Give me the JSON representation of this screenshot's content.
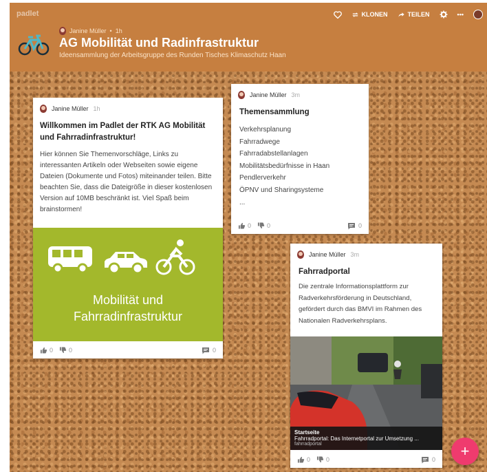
{
  "topbar": {
    "brand": "padlet",
    "actions": {
      "clone": "KLONEN",
      "share": "TEILEN",
      "more": "•••"
    }
  },
  "header": {
    "author": "Janine Müller",
    "time": "1h",
    "title": "AG Mobilität und Radinfrastruktur",
    "subtitle": "Ideensammlung der Arbeitsgruppe des Runden Tisches Klimaschutz Haan"
  },
  "posts": [
    {
      "author": "Janine Müller",
      "time": "1h",
      "title": "Willkommen im Padlet der RTK AG Mobilität und Fahrradinfrastruktur!",
      "body": "Hier können Sie Themenvorschläge, Links zu interessanten Artikeln oder Webseiten sowie eigene Dateien (Dokumente und Fotos) miteinander teilen. Bitte beachten Sie, dass die Dateigröße in dieser kostenlosen Version auf 10MB beschränkt ist. Viel Spaß beim brainstormen!",
      "image_caption_line1": "Mobilität und",
      "image_caption_line2": "Fahrradinfrastruktur",
      "likes": "0",
      "dislikes": "0",
      "comments": "0"
    },
    {
      "author": "Janine Müller",
      "time": "3m",
      "title": "Themensammlung",
      "items": [
        "Verkehrsplanung",
        "Fahrradwege",
        "Fahrradabstellanlagen",
        "Mobilitätsbedürfnisse in Haan",
        "Pendlerverkehr",
        "ÖPNV und Sharingsysteme",
        "..."
      ],
      "likes": "0",
      "dislikes": "0",
      "comments": "0"
    },
    {
      "author": "Janine Müller",
      "time": "3m",
      "title": "Fahrradportal",
      "body": "Die zentrale Informationsplattform zur Radverkehrsförderung in Deutschland, gefördert durch das BMVI im Rahmen des Nationalen Radverkehrsplans.",
      "link_label": "Startseite",
      "link_title": "Fahrradportal: Das Internetportal zur Umsetzung ...",
      "link_site": "fahrradportal",
      "likes": "0",
      "dislikes": "0",
      "comments": "0"
    }
  ],
  "fab": "+",
  "colors": {
    "header": "#c67f40",
    "accent_green": "#a3b82c",
    "fab": "#ef3b6e"
  }
}
